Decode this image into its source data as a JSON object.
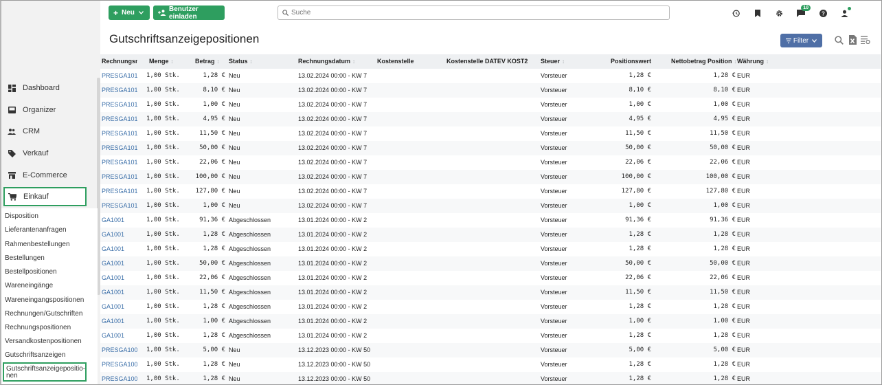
{
  "topbar": {
    "new_label": "Neu",
    "invite_label": "Benutzer einladen",
    "search_placeholder": "Suche",
    "notification_count": "10"
  },
  "page": {
    "title": "Gutschriftsanzeigepositionen",
    "filter_label": "Filter"
  },
  "sidebar": {
    "nav": [
      {
        "label": "Dashboard",
        "icon": "dashboard-icon"
      },
      {
        "label": "Organizer",
        "icon": "inbox-icon"
      },
      {
        "label": "CRM",
        "icon": "people-icon"
      },
      {
        "label": "Verkauf",
        "icon": "tag-icon"
      },
      {
        "label": "E-Commerce",
        "icon": "store-icon"
      },
      {
        "label": "Einkauf",
        "icon": "cart-icon"
      }
    ],
    "sub": [
      "Disposition",
      "Lieferantenanfragen",
      "Rahmenbestellungen",
      "Bestellungen",
      "Bestellpositionen",
      "Wareneingänge",
      "Wareneingangspositionen",
      "Rechnungen/Gutschriften",
      "Rechnungspositionen",
      "Versandkostenpositionen",
      "Gutschriftsanzeigen",
      "Gutschriftsanzeigepositio-nen"
    ]
  },
  "table": {
    "columns": [
      "Rechnungsnummer",
      "Menge",
      "Betrag",
      "Status",
      "Rechnungsdatum",
      "Kostenstelle",
      "Kostenstelle DATEV KOST2",
      "Steuer",
      "Positionswert",
      "Nettobetrag Position",
      "Währung"
    ],
    "rows": [
      [
        "PRESGA101",
        "1,00 Stk.",
        "1,28 €",
        "Neu",
        "13.02.2024 00:00 - KW 7",
        "",
        "",
        "Vorsteuer",
        "1,28 €",
        "1,28 €",
        "EUR"
      ],
      [
        "PRESGA101",
        "1,00 Stk.",
        "8,10 €",
        "Neu",
        "13.02.2024 00:00 - KW 7",
        "",
        "",
        "Vorsteuer",
        "8,10 €",
        "8,10 €",
        "EUR"
      ],
      [
        "PRESGA101",
        "1,00 Stk.",
        "1,00 €",
        "Neu",
        "13.02.2024 00:00 - KW 7",
        "",
        "",
        "Vorsteuer",
        "1,00 €",
        "1,00 €",
        "EUR"
      ],
      [
        "PRESGA101",
        "1,00 Stk.",
        "4,95 €",
        "Neu",
        "13.02.2024 00:00 - KW 7",
        "",
        "",
        "Vorsteuer",
        "4,95 €",
        "4,95 €",
        "EUR"
      ],
      [
        "PRESGA101",
        "1,00 Stk.",
        "11,50 €",
        "Neu",
        "13.02.2024 00:00 - KW 7",
        "",
        "",
        "Vorsteuer",
        "11,50 €",
        "11,50 €",
        "EUR"
      ],
      [
        "PRESGA101",
        "1,00 Stk.",
        "50,00 €",
        "Neu",
        "13.02.2024 00:00 - KW 7",
        "",
        "",
        "Vorsteuer",
        "50,00 €",
        "50,00 €",
        "EUR"
      ],
      [
        "PRESGA101",
        "1,00 Stk.",
        "22,06 €",
        "Neu",
        "13.02.2024 00:00 - KW 7",
        "",
        "",
        "Vorsteuer",
        "22,06 €",
        "22,06 €",
        "EUR"
      ],
      [
        "PRESGA101",
        "1,00 Stk.",
        "100,00 €",
        "Neu",
        "13.02.2024 00:00 - KW 7",
        "",
        "",
        "Vorsteuer",
        "100,00 €",
        "100,00 €",
        "EUR"
      ],
      [
        "PRESGA101",
        "1,00 Stk.",
        "127,80 €",
        "Neu",
        "13.02.2024 00:00 - KW 7",
        "",
        "",
        "Vorsteuer",
        "127,80 €",
        "127,80 €",
        "EUR"
      ],
      [
        "PRESGA101",
        "1,00 Stk.",
        "1,00 €",
        "Neu",
        "13.02.2024 00:00 - KW 7",
        "",
        "",
        "Vorsteuer",
        "1,00 €",
        "1,00 €",
        "EUR"
      ],
      [
        "GA1001",
        "1,00 Stk.",
        "91,36 €",
        "Abgeschlossen",
        "13.01.2024 00:00 - KW 2",
        "",
        "",
        "Vorsteuer",
        "91,36 €",
        "91,36 €",
        "EUR"
      ],
      [
        "GA1001",
        "1,00 Stk.",
        "1,28 €",
        "Abgeschlossen",
        "13.01.2024 00:00 - KW 2",
        "",
        "",
        "Vorsteuer",
        "1,28 €",
        "1,28 €",
        "EUR"
      ],
      [
        "GA1001",
        "1,00 Stk.",
        "1,28 €",
        "Abgeschlossen",
        "13.01.2024 00:00 - KW 2",
        "",
        "",
        "Vorsteuer",
        "1,28 €",
        "1,28 €",
        "EUR"
      ],
      [
        "GA1001",
        "1,00 Stk.",
        "50,00 €",
        "Abgeschlossen",
        "13.01.2024 00:00 - KW 2",
        "",
        "",
        "Vorsteuer",
        "50,00 €",
        "50,00 €",
        "EUR"
      ],
      [
        "GA1001",
        "1,00 Stk.",
        "22,06 €",
        "Abgeschlossen",
        "13.01.2024 00:00 - KW 2",
        "",
        "",
        "Vorsteuer",
        "22,06 €",
        "22,06 €",
        "EUR"
      ],
      [
        "GA1001",
        "1,00 Stk.",
        "11,50 €",
        "Abgeschlossen",
        "13.01.2024 00:00 - KW 2",
        "",
        "",
        "Vorsteuer",
        "11,50 €",
        "11,50 €",
        "EUR"
      ],
      [
        "GA1001",
        "1,00 Stk.",
        "1,28 €",
        "Abgeschlossen",
        "13.01.2024 00:00 - KW 2",
        "",
        "",
        "Vorsteuer",
        "1,28 €",
        "1,28 €",
        "EUR"
      ],
      [
        "GA1001",
        "1,00 Stk.",
        "1,00 €",
        "Abgeschlossen",
        "13.01.2024 00:00 - KW 2",
        "",
        "",
        "Vorsteuer",
        "1,00 €",
        "1,00 €",
        "EUR"
      ],
      [
        "GA1001",
        "1,00 Stk.",
        "1,28 €",
        "Abgeschlossen",
        "13.01.2024 00:00 - KW 2",
        "",
        "",
        "Vorsteuer",
        "1,28 €",
        "1,28 €",
        "EUR"
      ],
      [
        "PRESGA100",
        "1,00 Stk.",
        "5,00 €",
        "Neu",
        "13.12.2023 00:00 - KW 50",
        "",
        "",
        "Vorsteuer",
        "5,00 €",
        "5,00 €",
        "EUR"
      ],
      [
        "PRESGA100",
        "1,00 Stk.",
        "1,28 €",
        "Neu",
        "13.12.2023 00:00 - KW 50",
        "",
        "",
        "Vorsteuer",
        "1,28 €",
        "1,28 €",
        "EUR"
      ],
      [
        "PRESGA100",
        "1,00 Stk.",
        "1,28 €",
        "Neu",
        "13.12.2023 00:00 - KW 50",
        "",
        "",
        "Vorsteuer",
        "1,28 €",
        "1,28 €",
        "EUR"
      ]
    ]
  },
  "colors": {
    "accent_green": "#2e9e5f",
    "filter_blue": "#4f6fa6",
    "link_blue": "#3a6ea8"
  }
}
